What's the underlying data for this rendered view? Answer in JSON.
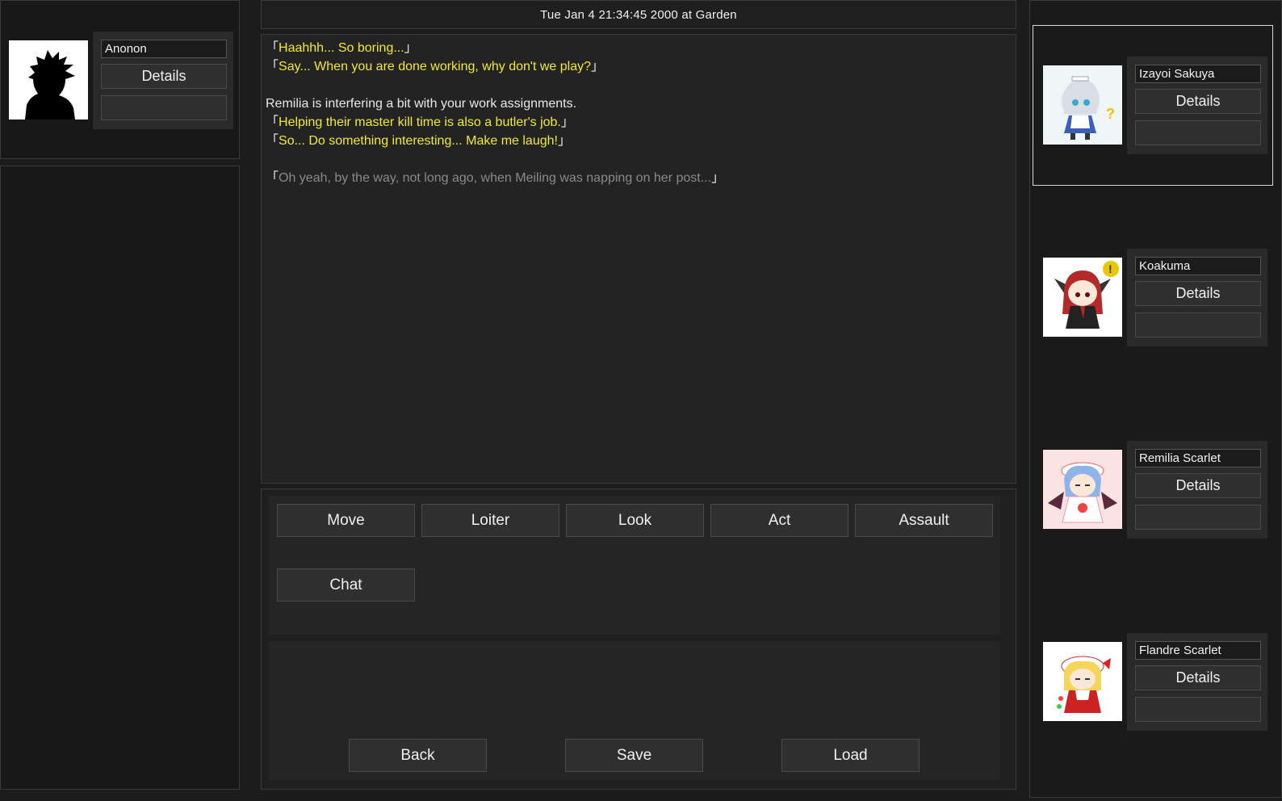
{
  "header": {
    "datetime_location": "Tue Jan  4 21:34:45 2000 at Garden"
  },
  "player": {
    "name": "Anonon",
    "details_label": "Details",
    "extra_label": "",
    "portrait_icon": "silhouette-icon"
  },
  "log": [
    {
      "open": "「",
      "text": "Haahhh... So boring...",
      "close": "」",
      "color": "yellow"
    },
    {
      "open": "「",
      "text": "Say... When you are done working, why don't we play?",
      "close": "」",
      "color": "yellow"
    },
    {
      "open": "",
      "text": "",
      "close": "",
      "color": "white"
    },
    {
      "open": "",
      "text": "Remilia is interfering a bit with your work assignments.",
      "close": "",
      "color": "white"
    },
    {
      "open": "「",
      "text": "Helping their master kill time is also a butler's job.",
      "close": "」",
      "color": "yellow"
    },
    {
      "open": "「",
      "text": "So... Do something interesting... Make me laugh!",
      "close": "」",
      "color": "yellow"
    },
    {
      "open": "",
      "text": "",
      "close": "",
      "color": "white"
    },
    {
      "open": "「",
      "text": "Oh yeah, by the way, not long ago, when Meiling was napping on her post...",
      "close": "」",
      "color": "gray"
    }
  ],
  "actions": {
    "move": "Move",
    "loiter": "Loiter",
    "look": "Look",
    "act": "Act",
    "assault": "Assault",
    "chat": "Chat"
  },
  "system": {
    "back": "Back",
    "save": "Save",
    "load": "Load"
  },
  "characters": [
    {
      "name": "Izayoi Sakuya",
      "details_label": "Details",
      "extra_label": "",
      "selected": true,
      "badge": "question-mark-icon"
    },
    {
      "name": "Koakuma",
      "details_label": "Details",
      "extra_label": "",
      "selected": false,
      "badge": "exclamation-icon"
    },
    {
      "name": "Remilia Scarlet",
      "details_label": "Details",
      "extra_label": "",
      "selected": false,
      "badge": ""
    },
    {
      "name": "Flandre Scarlet",
      "details_label": "Details",
      "extra_label": "",
      "selected": false,
      "badge": ""
    }
  ],
  "colors": {
    "dialogue": "#f2ea2a",
    "narration": "#e8e8e8",
    "faded": "#8a8a8a",
    "background": "#1c1c1c"
  }
}
